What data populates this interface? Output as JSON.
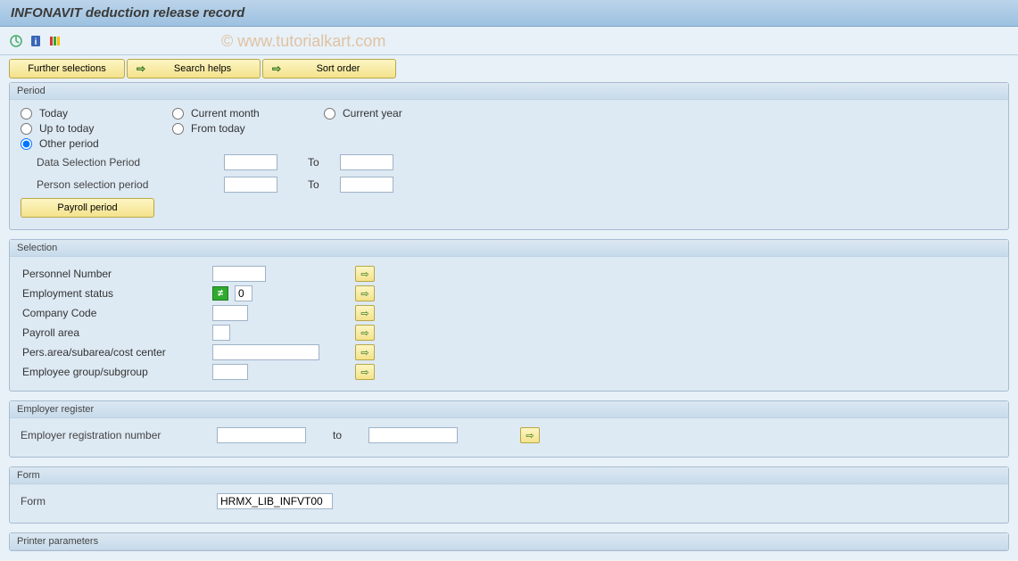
{
  "title": "INFONAVIT deduction release record",
  "watermark": "© www.tutorialkart.com",
  "toolbar_buttons": {
    "further_selections": "Further selections",
    "search_helps": "Search helps",
    "sort_order": "Sort order"
  },
  "period": {
    "group_title": "Period",
    "radios": {
      "today": "Today",
      "current_month": "Current month",
      "current_year": "Current year",
      "up_to_today": "Up to today",
      "from_today": "From today",
      "other_period": "Other period"
    },
    "selected": "other_period",
    "data_selection_label": "Data Selection Period",
    "person_selection_label": "Person selection period",
    "to_label": "To",
    "data_from": "",
    "data_to": "",
    "person_from": "",
    "person_to": "",
    "payroll_period_btn": "Payroll period"
  },
  "selection": {
    "group_title": "Selection",
    "rows": [
      {
        "label": "Personnel Number",
        "value": "",
        "width": "w60"
      },
      {
        "label": "Employment status",
        "value": "0",
        "width": "w20",
        "neq": true
      },
      {
        "label": "Company Code",
        "value": "",
        "width": "w40"
      },
      {
        "label": "Payroll area",
        "value": "",
        "width": "w20"
      },
      {
        "label": "Pers.area/subarea/cost center",
        "value": "",
        "width": "w120"
      },
      {
        "label": "Employee group/subgroup",
        "value": "",
        "width": "w40"
      }
    ]
  },
  "employer_register": {
    "group_title": "Employer register",
    "label": "Employer registration number",
    "from": "",
    "to_label": "to",
    "to": ""
  },
  "form_group": {
    "group_title": "Form",
    "label": "Form",
    "value": "HRMX_LIB_INFVT00"
  },
  "printer_group": {
    "group_title": "Printer parameters"
  }
}
